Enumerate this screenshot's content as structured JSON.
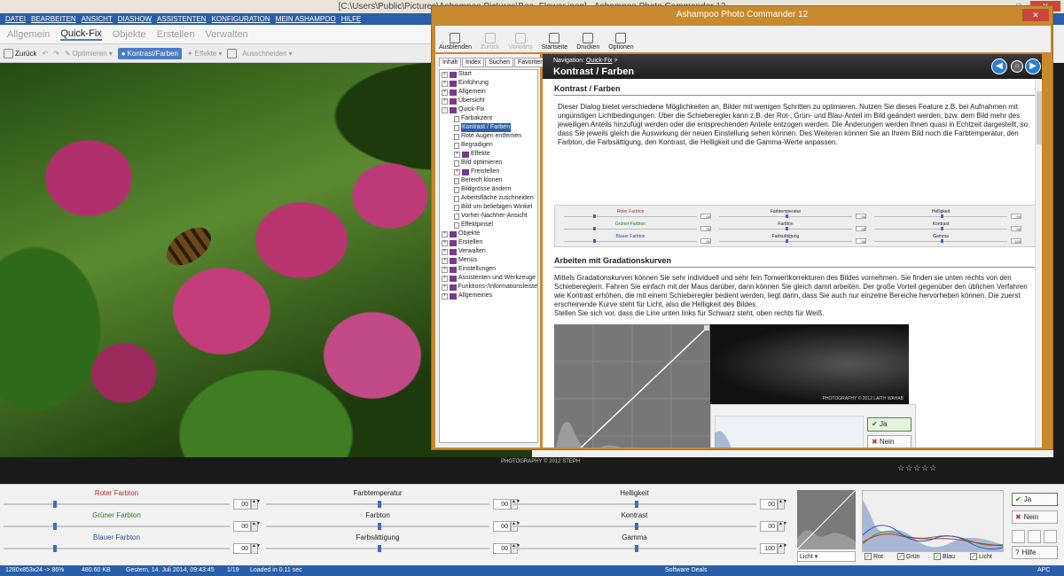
{
  "window": {
    "title": "[C:\\Users\\Public\\Pictures\\Ashampoo Pictures\\Bee_Flower.jpeg] - Ashampoo Photo Commander 12",
    "controls": [
      "–",
      "□",
      "✕"
    ]
  },
  "menu": [
    "DATEI",
    "BEARBEITEN",
    "ANSICHT",
    "DIASHOW",
    "ASSISTENTEN",
    "KONFIGURATION",
    "MEIN ASHAMPOO",
    "HILFE"
  ],
  "tabs": [
    {
      "label": "Allgemein",
      "active": false
    },
    {
      "label": "Quick-Fix",
      "active": true
    },
    {
      "label": "Objekte",
      "active": false
    },
    {
      "label": "Erstellen",
      "active": false
    },
    {
      "label": "Verwalten",
      "active": false
    }
  ],
  "toolbar": {
    "back": "Zurück",
    "optimize": "Optimieren",
    "contrast": "Kontrast/Farben",
    "effects": "Effekte",
    "cutout": "Ausschneiden"
  },
  "photo": {
    "watermark": "PHOTOGRAPHY © 2012 STEPH"
  },
  "sliders": [
    {
      "label": "Roter Farbton",
      "value": "00",
      "color": "#b03030",
      "level": 0.22
    },
    {
      "label": "Grüner Farbton",
      "value": "00",
      "color": "#2a7a2a",
      "level": 0.22
    },
    {
      "label": "Blauer Farbton",
      "value": "00",
      "color": "#2a4aa0",
      "level": 0.22
    },
    {
      "label": "Farbtemperatur",
      "value": "00",
      "color": "#222222",
      "level": 0.5
    },
    {
      "label": "Farbton",
      "value": "00",
      "color": "#222222",
      "level": 0.5
    },
    {
      "label": "Farbsättigung",
      "value": "00",
      "color": "#222222",
      "level": 0.5
    },
    {
      "label": "Helligkeit",
      "value": "00",
      "color": "#222222",
      "level": 0.5
    },
    {
      "label": "Kontrast",
      "value": "00",
      "color": "#222222",
      "level": 0.5
    },
    {
      "label": "Gamma",
      "value": "100",
      "color": "#222222",
      "level": 0.5
    }
  ],
  "curve": {
    "dropdown": "Licht"
  },
  "channels": [
    {
      "label": "Rot",
      "checked": true
    },
    {
      "label": "Grün",
      "checked": true
    },
    {
      "label": "Blau",
      "checked": true
    },
    {
      "label": "Licht",
      "checked": true
    }
  ],
  "actions": {
    "yes": "Ja",
    "no": "Nein",
    "help": "Hilfe"
  },
  "status": {
    "dimensions": "1280x853x24 -> 86%",
    "size": "480.60 KB",
    "date": "Gestern, 14. Juli 2014, 09:43:45",
    "index": "1/19",
    "loaded": "Loaded in 0.11 sec",
    "deals": "Software Deals",
    "apc": "APC"
  },
  "help": {
    "title": "Ashampoo Photo Commander 12",
    "toolbar": [
      {
        "label": "Ausblenden",
        "enabled": true
      },
      {
        "label": "Zurück",
        "enabled": false
      },
      {
        "label": "Vorwärts",
        "enabled": false
      },
      {
        "label": "Startseite",
        "enabled": true
      },
      {
        "label": "Drucken",
        "enabled": true
      },
      {
        "label": "Optionen",
        "enabled": true
      }
    ],
    "tabs": [
      "Inhalt",
      "Index",
      "Suchen",
      "Favoriten"
    ],
    "tree": [
      {
        "label": "Start",
        "type": "book",
        "indent": 0
      },
      {
        "label": "Einführung",
        "type": "book",
        "indent": 0
      },
      {
        "label": "Allgemein",
        "type": "book",
        "indent": 0
      },
      {
        "label": "Übersicht",
        "type": "book",
        "indent": 0
      },
      {
        "label": "Quick-Fix",
        "type": "open",
        "indent": 0
      },
      {
        "label": "Farbakzent",
        "type": "page",
        "indent": 1
      },
      {
        "label": "Kontrast / Farben",
        "type": "page",
        "indent": 1,
        "selected": true
      },
      {
        "label": "Rote Augen entfernen",
        "type": "page",
        "indent": 1
      },
      {
        "label": "Begradigen",
        "type": "page",
        "indent": 1
      },
      {
        "label": "Effekte",
        "type": "book",
        "indent": 1
      },
      {
        "label": "Bild optimieren",
        "type": "page",
        "indent": 1
      },
      {
        "label": "Freistellen",
        "type": "book",
        "indent": 1
      },
      {
        "label": "Bereich klonen",
        "type": "page",
        "indent": 1
      },
      {
        "label": "Bildgrösse ändern",
        "type": "page",
        "indent": 1
      },
      {
        "label": "Arbeitsfläche zuschneiden",
        "type": "page",
        "indent": 1
      },
      {
        "label": "Bild um beliebigen Winkel",
        "type": "page",
        "indent": 1
      },
      {
        "label": "Vorher-Nachher-Ansicht",
        "type": "page",
        "indent": 1
      },
      {
        "label": "Effektpinsel",
        "type": "page",
        "indent": 1
      },
      {
        "label": "Objekte",
        "type": "book",
        "indent": 0
      },
      {
        "label": "Erstellen",
        "type": "book",
        "indent": 0
      },
      {
        "label": "Verwalten",
        "type": "book",
        "indent": 0
      },
      {
        "label": "Menüs",
        "type": "book",
        "indent": 0
      },
      {
        "label": "Einstellungen",
        "type": "book",
        "indent": 0
      },
      {
        "label": "Assistenten und Werkzeuge",
        "type": "book",
        "indent": 0
      },
      {
        "label": "Funktions-/Informationsleiste",
        "type": "book",
        "indent": 0
      },
      {
        "label": "Allgemeines",
        "type": "book",
        "indent": 0
      }
    ],
    "nav_prefix": "Navigation:",
    "nav_link": "Quick-Fix",
    "nav_suffix": " >",
    "page_title": "Kontrast / Farben",
    "heading1": "Kontrast / Farben",
    "intro": "Dieser Dialog bietet verschiedene Möglichkeiten an, Bilder mit wenigen Schritten zu optimieren. Nutzen Sie dieses Feature z.B. bei Aufnahmen mit ungünstigen Lichtbedingungen. Über die Schieberegler kann z.B. der Rot-, Grün- und Blau-Anteil im Bild geändert werden, bzw. dem Bild mehr des jeweiligen Anteils hinzufügt werden oder die entsprechenden Anteile entzogen werden. Die Änderungen werden Ihnen quasi in Echtzeit dargestellt, so dass Sie jeweils gleich die Auswirkung der neuen Einstellung sehen können. Des Weiteren können Sie an Ihrem Bild noch die Farbtemperatur, den Farbton, die Farbsättigung, den Kontrast, die Helligkeit und die Gamma-Werte anpassen.",
    "heading2": "Arbeiten mit Gradationskurven",
    "curves_text": "Mittels Gradationskurven können Sie sehr individuell und sehr fein Tonwertkorrekturen des Bildes vornehmen. Sie finden sie unten rechts von den Schiebereglern. Fahren Sie einfach mit der Maus darüber, dann können Sie gleich damit arbeiten. Der große Vorteil gegenüber den üblichen Verfahren wie Kontrast erhöhen, die mit einem Schieberegler bedient werden, liegt darin, dass Sie auch nur einzelne Bereiche hervorheben können. Die zuerst erscheinende Kurve steht für Licht, also die Helligkeit des Bildes.",
    "curves_text2": "Stellen Sie sich vor, dass die Line unten links für Schwarz steht, oben rechts für Weiß.",
    "fig_watermark": "PHOTOGRAPHY © 2012 LAITH WAHAB",
    "fig_yes": "Ja",
    "fig_no": "Nein"
  }
}
